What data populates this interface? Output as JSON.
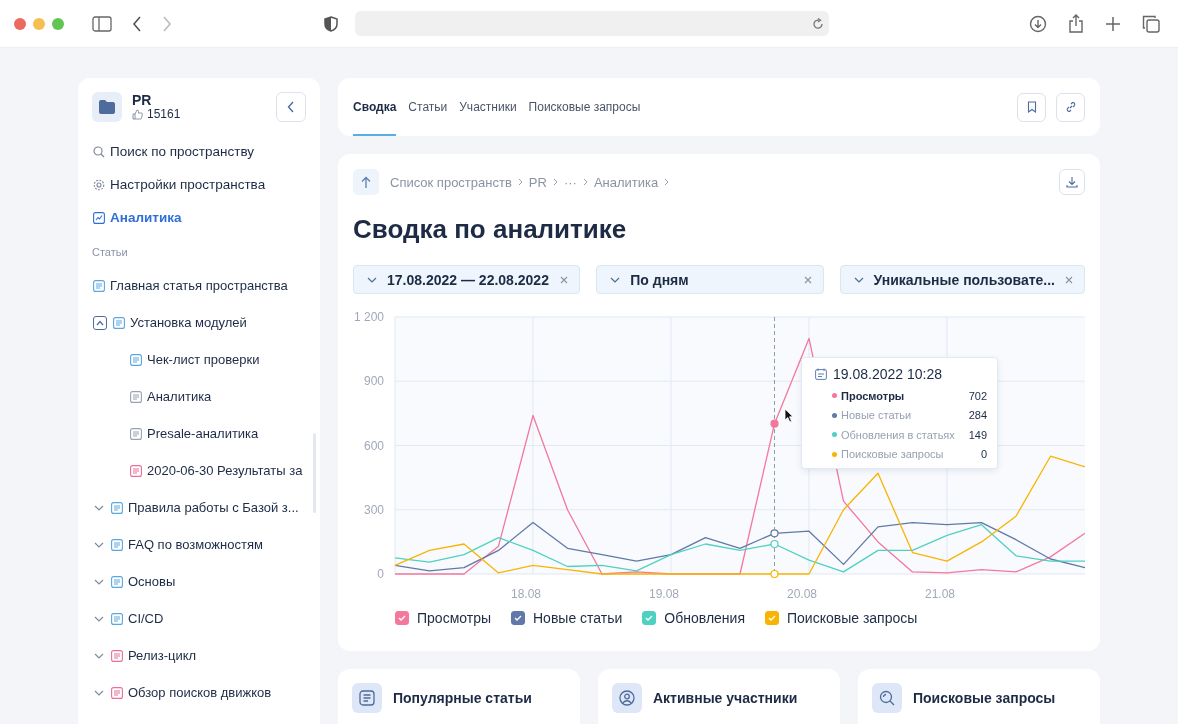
{
  "sidebar": {
    "space": {
      "name": "PR",
      "likes": "15161"
    },
    "nav": [
      {
        "label": "Поиск по пространству",
        "kind": "search",
        "selected": false
      },
      {
        "label": "Настройки пространства",
        "kind": "settings",
        "selected": false
      },
      {
        "label": "Аналитика",
        "kind": "analytics",
        "selected": true
      }
    ],
    "section_label": "Статьи",
    "tree": [
      {
        "label": "Главная статья пространства",
        "kind": "home"
      },
      {
        "label": "Установка модулей",
        "kind": "article",
        "expanded": true,
        "children": [
          {
            "label": "Чек-лист проверки",
            "kind": "article"
          },
          {
            "label": "Аналитика",
            "kind": "draft"
          },
          {
            "label": "Presale-аналитика",
            "kind": "draft"
          },
          {
            "label": "2020-06-30 Результаты за",
            "kind": "board"
          }
        ]
      },
      {
        "label": "Правила работы с Базой з...",
        "kind": "article",
        "expanded": false
      },
      {
        "label": "FAQ по возможностям",
        "kind": "article",
        "expanded": false
      },
      {
        "label": "Основы",
        "kind": "article",
        "expanded": false
      },
      {
        "label": "CI/CD",
        "kind": "article",
        "expanded": false
      },
      {
        "label": "Релиз-цикл",
        "kind": "board",
        "expanded": false
      },
      {
        "label": "Обзор поисков движков",
        "kind": "board",
        "expanded": false
      }
    ]
  },
  "tabs": [
    {
      "label": "Сводка",
      "selected": true
    },
    {
      "label": "Статьи",
      "selected": false
    },
    {
      "label": "Участники",
      "selected": false
    },
    {
      "label": "Поисковые запросы",
      "selected": false
    }
  ],
  "breadcrumb": [
    "Список пространств",
    "PR",
    "···",
    "Аналитика"
  ],
  "title": "Сводка по аналитике",
  "filters": [
    {
      "value": "17.08.2022 — 22.08.2022"
    },
    {
      "value": "По дням"
    },
    {
      "value": "Уникальные пользовате..."
    }
  ],
  "chart_data": {
    "type": "line",
    "categories": [
      null,
      null,
      null,
      null,
      "18.08",
      null,
      null,
      null,
      "19.08",
      null,
      null,
      null,
      "20.08",
      null,
      null,
      null,
      "21.08",
      null,
      null,
      null,
      null
    ],
    "ylim": [
      0,
      1200
    ],
    "yticks": [
      {
        "value": 0,
        "label": "0"
      },
      {
        "value": 300,
        "label": "300"
      },
      {
        "value": 600,
        "label": "600"
      },
      {
        "value": 900,
        "label": "900"
      },
      {
        "value": 1200,
        "label": "1 200"
      }
    ],
    "series": [
      {
        "name": "Просмотры",
        "color": "#f4779c",
        "values": [
          0,
          0,
          0,
          130,
          740,
          300,
          0,
          10,
          0,
          0,
          0,
          702,
          1100,
          340,
          150,
          10,
          5,
          20,
          10,
          80,
          190
        ]
      },
      {
        "name": "Новые статьи",
        "color": "#6079a8",
        "values": [
          40,
          15,
          30,
          110,
          240,
          120,
          90,
          60,
          90,
          170,
          120,
          190,
          200,
          45,
          220,
          240,
          230,
          240,
          160,
          70,
          30
        ]
      },
      {
        "name": "Обновления",
        "color": "#4fd1c1",
        "values": [
          75,
          55,
          90,
          170,
          110,
          35,
          40,
          15,
          90,
          140,
          110,
          140,
          65,
          10,
          110,
          110,
          180,
          230,
          85,
          60,
          60
        ]
      },
      {
        "name": "Поисковые запросы",
        "color": "#f8b400",
        "values": [
          40,
          110,
          140,
          5,
          40,
          20,
          0,
          0,
          0,
          0,
          0,
          0,
          0,
          300,
          470,
          100,
          60,
          150,
          270,
          550,
          500
        ]
      }
    ],
    "grid": true
  },
  "legend": [
    {
      "checked": true
    },
    {
      "checked": true
    },
    {
      "checked": true
    },
    {
      "checked": true
    }
  ],
  "tooltip": {
    "date": "19.08.2022 10:28",
    "rows": [
      {
        "label": "Просмотры",
        "value": "702",
        "selected": true,
        "color": "#f4779c"
      },
      {
        "label": "Новые статьи",
        "value": "284",
        "selected": false,
        "color": "#6079a8"
      },
      {
        "label": "Обновления в статьях",
        "value": "149",
        "selected": false,
        "color": "#4fd1c1"
      },
      {
        "label": "Поисковые запросы",
        "value": "0",
        "selected": false,
        "color": "#f8b400"
      }
    ]
  },
  "cards": [
    {
      "title": "Популярные статьи",
      "kind": "articles"
    },
    {
      "title": "Активные участники",
      "kind": "users"
    },
    {
      "title": "Поисковые запросы",
      "kind": "search"
    }
  ]
}
